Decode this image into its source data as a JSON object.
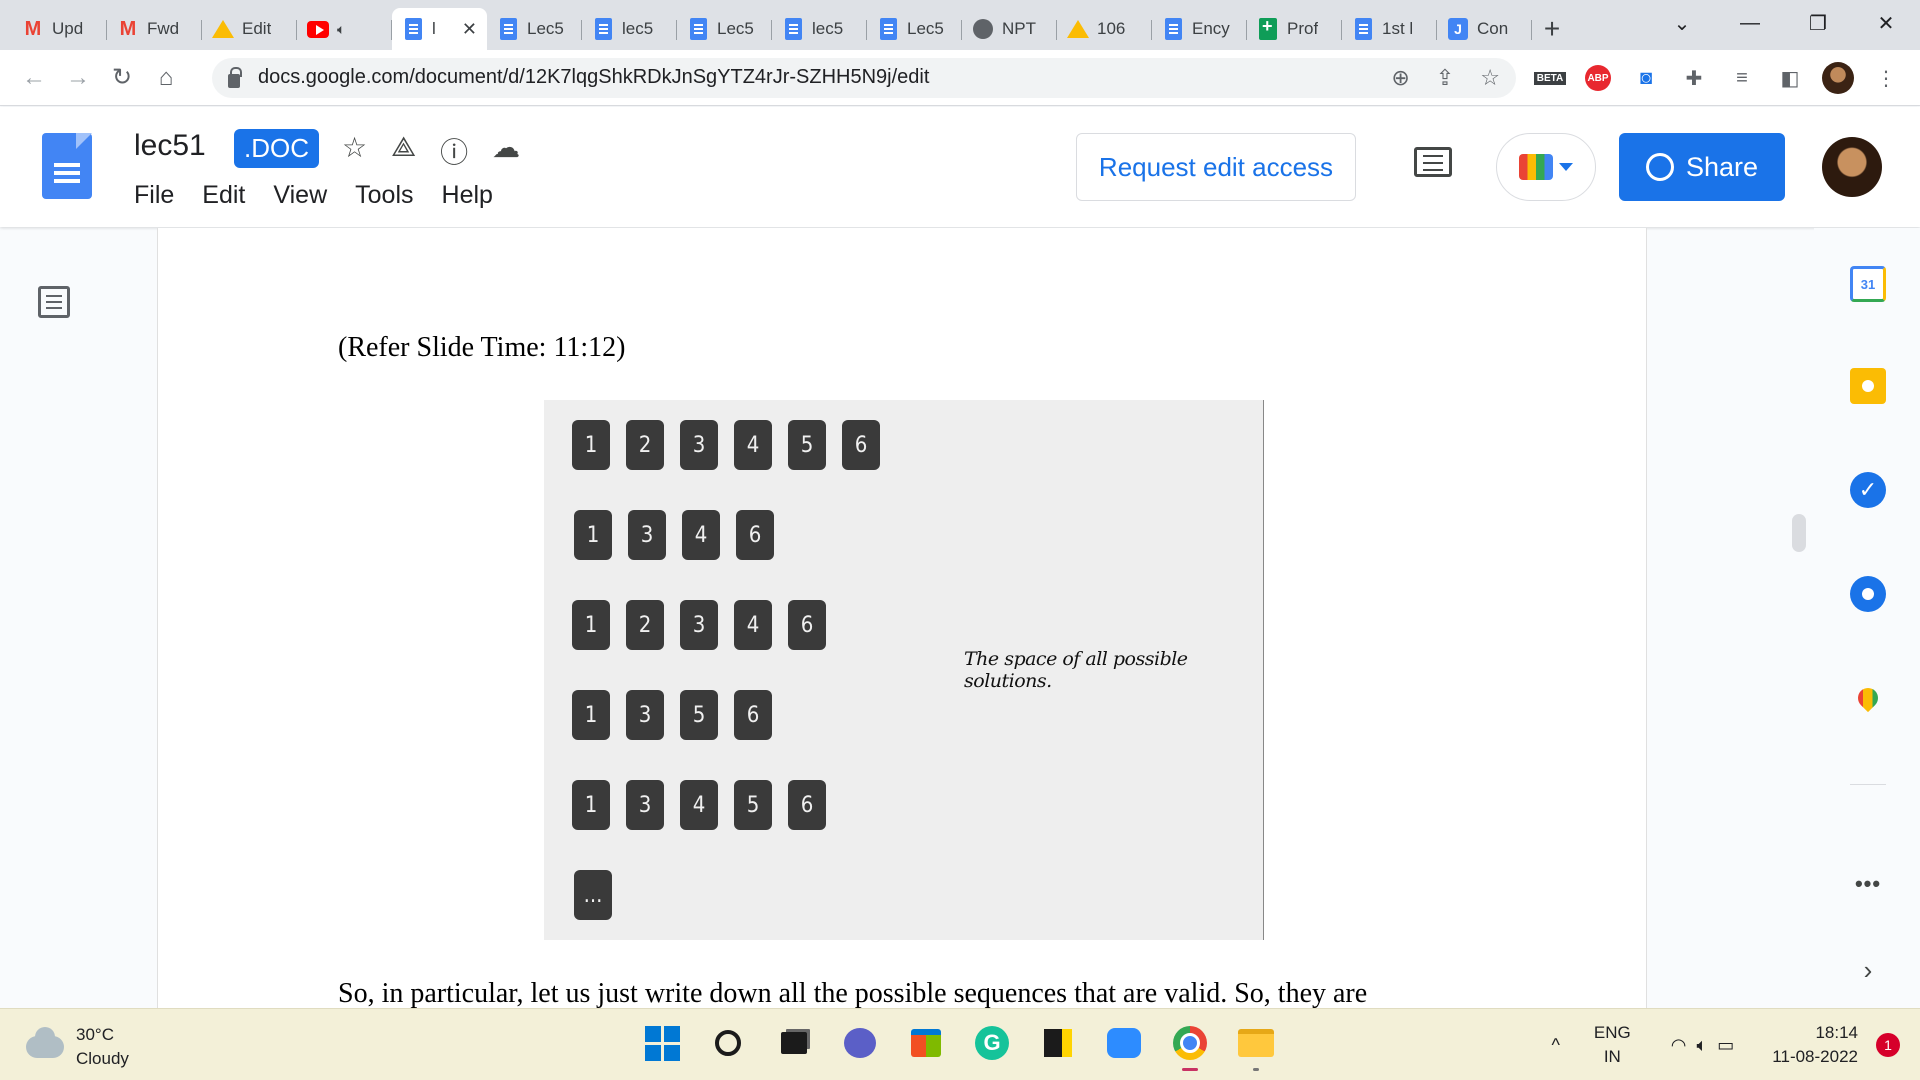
{
  "browser": {
    "tabs": [
      {
        "title": "Upd",
        "icon": "gmail-icon"
      },
      {
        "title": "Fwd",
        "icon": "gmail-icon"
      },
      {
        "title": "Edit",
        "icon": "drive-icon"
      },
      {
        "title": "",
        "icon": "youtube-icon"
      },
      {
        "title": "l",
        "icon": "docs-icon",
        "active": true
      },
      {
        "title": "Lec5",
        "icon": "docs-icon"
      },
      {
        "title": "lec5",
        "icon": "docs-icon"
      },
      {
        "title": "Lec5",
        "icon": "docs-icon"
      },
      {
        "title": "lec5",
        "icon": "docs-icon"
      },
      {
        "title": "Lec5",
        "icon": "docs-icon"
      },
      {
        "title": "NPT",
        "icon": "globe-icon"
      },
      {
        "title": "106",
        "icon": "drive-icon"
      },
      {
        "title": "Ency",
        "icon": "docs-icon"
      },
      {
        "title": "Prof",
        "icon": "sheets-icon"
      },
      {
        "title": "1st l",
        "icon": "docs-icon"
      },
      {
        "title": "Con",
        "icon": "j-icon"
      }
    ],
    "url": "docs.google.com/document/d/12K7lqgShkRDkJnSgYTZ4rJr-SZHH5N9j/edit",
    "beta_label": "BETA",
    "abp_label": "ABP"
  },
  "doc": {
    "title": "lec51",
    "badge": ".DOC",
    "menu": [
      "File",
      "Edit",
      "View",
      "Tools",
      "Help"
    ],
    "request_edit": "Request edit access",
    "share": "Share"
  },
  "content": {
    "slide_ref": "(Refer Slide Time: 11:12)",
    "sequences": [
      [
        "1",
        "2",
        "3",
        "4",
        "5",
        "6"
      ],
      [
        "1",
        "3",
        "4",
        "6"
      ],
      [
        "1",
        "2",
        "3",
        "4",
        "6"
      ],
      [
        "1",
        "3",
        "5",
        "6"
      ],
      [
        "1",
        "3",
        "4",
        "5",
        "6"
      ],
      [
        "..."
      ]
    ],
    "slide_note": "The space of all possible solutions.",
    "paragraph": "So, in particular, let us just write down all the possible sequences that are valid. So, they are"
  },
  "sidepanel": {
    "calendar_day": "31"
  },
  "taskbar": {
    "temp": "30°C",
    "condition": "Cloudy",
    "lang1": "ENG",
    "lang2": "IN",
    "time": "18:14",
    "date": "11-08-2022",
    "notifications": "1"
  }
}
